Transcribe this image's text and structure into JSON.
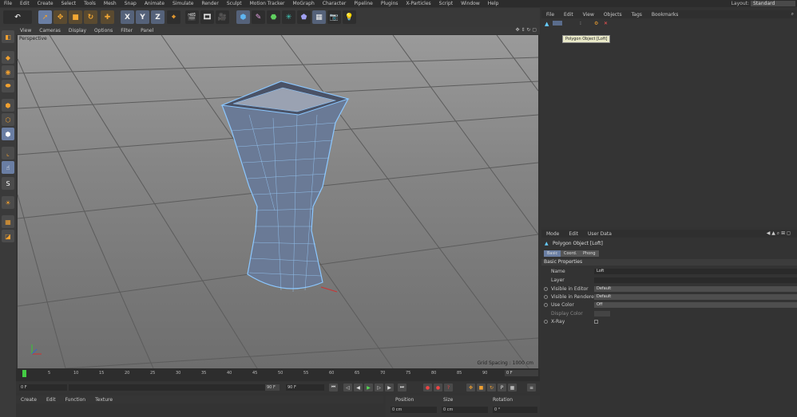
{
  "menu": [
    "File",
    "Edit",
    "Create",
    "Select",
    "Tools",
    "Mesh",
    "Snap",
    "Animate",
    "Simulate",
    "Render",
    "Sculpt",
    "Motion Tracker",
    "MoGraph",
    "Character",
    "Pipeline",
    "Plugins",
    "X-Particles",
    "Script",
    "Window",
    "Help"
  ],
  "layout": {
    "label": "Layout:",
    "value": "Standard"
  },
  "toolbar": {
    "x": "X",
    "y": "Y",
    "z": "Z"
  },
  "viewport": {
    "menu": [
      "View",
      "Cameras",
      "Display",
      "Options",
      "Filter",
      "Panel"
    ],
    "label": "Perspective",
    "grid_spacing": "Grid Spacing : 1000 cm"
  },
  "timeline": {
    "ticks": [
      "0",
      "5",
      "10",
      "15",
      "20",
      "25",
      "30",
      "35",
      "40",
      "45",
      "50",
      "55",
      "60",
      "65",
      "70",
      "75",
      "80",
      "85",
      "90"
    ],
    "current": "0 F"
  },
  "transport": {
    "start": "0 F",
    "mid": "90 F",
    "end": "90 F"
  },
  "material_menu": [
    "Create",
    "Edit",
    "Function",
    "Texture"
  ],
  "coords": {
    "position": "Position",
    "size": "Size",
    "rotation": "Rotation",
    "pos_x": "0 cm",
    "size_x": "0 cm",
    "rot_h": "0 °"
  },
  "object_manager": {
    "menu": [
      "File",
      "Edit",
      "View",
      "Objects",
      "Tags",
      "Bookmarks"
    ],
    "tooltip": "Polygon Object [Loft]"
  },
  "attributes": {
    "menu": [
      "Mode",
      "Edit",
      "User Data"
    ],
    "object_title": "Polygon Object [Loft]",
    "tabs": [
      "Basic",
      "Coord.",
      "Phong"
    ],
    "section": "Basic Properties",
    "props": [
      {
        "label": "Name",
        "value": "Loft"
      },
      {
        "label": "Layer",
        "value": ""
      },
      {
        "label": "Visible in Editor",
        "value": "Default"
      },
      {
        "label": "Visible in Renderer",
        "value": "Default"
      },
      {
        "label": "Use Color",
        "value": "Off"
      },
      {
        "label": "Display Color",
        "value": ""
      },
      {
        "label": "X-Ray",
        "value": ""
      }
    ]
  }
}
